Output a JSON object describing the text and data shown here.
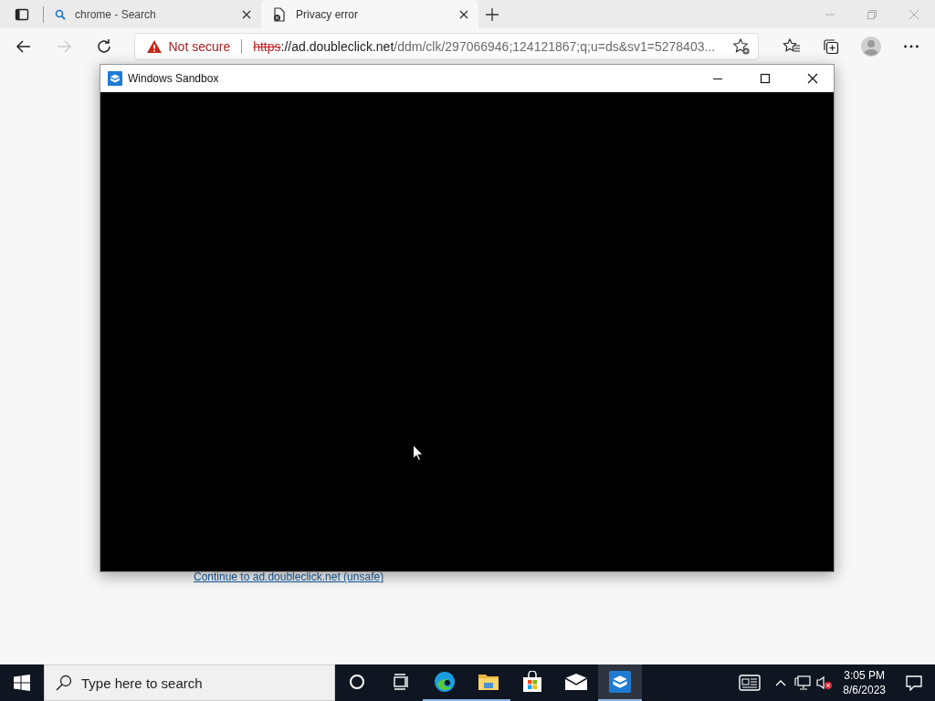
{
  "browser": {
    "tabs": [
      {
        "title": "chrome - Search",
        "selected": false,
        "kind": "search"
      },
      {
        "title": "Privacy error",
        "selected": true,
        "kind": "error"
      }
    ],
    "address": {
      "security": "Not secure",
      "scheme": "https",
      "host": "://ad.doubleclick.net",
      "path": "/ddm/clk/297066946;124121867;q;u=ds&sv1=5278403..."
    },
    "page": {
      "link": "Continue to ad.doubleclick.net (unsafe)"
    }
  },
  "sandbox": {
    "title": "Windows Sandbox"
  },
  "taskbar": {
    "search_placeholder": "Type here to search",
    "apps": [
      {
        "kind": "edge",
        "running": true,
        "selected": false
      },
      {
        "kind": "explorer",
        "running": true,
        "selected": false
      },
      {
        "kind": "store",
        "running": false,
        "selected": false
      },
      {
        "kind": "mail",
        "running": false,
        "selected": false
      },
      {
        "kind": "sandbox",
        "running": true,
        "selected": true
      }
    ],
    "time": "3:05 PM",
    "date": "8/6/2023"
  }
}
